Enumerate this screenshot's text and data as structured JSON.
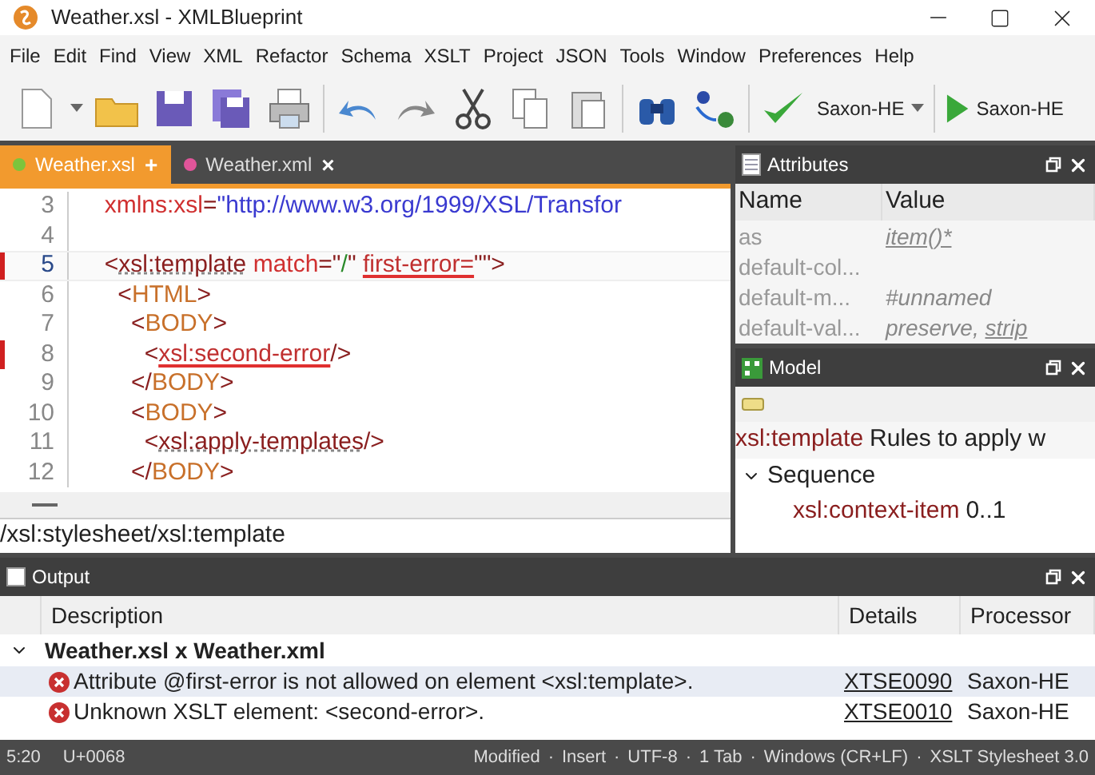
{
  "window": {
    "title": "Weather.xsl - XMLBlueprint"
  },
  "menu": [
    "File",
    "Edit",
    "Find",
    "View",
    "XML",
    "Refactor",
    "Schema",
    "XSLT",
    "Project",
    "JSON",
    "Tools",
    "Window",
    "Preferences",
    "Help"
  ],
  "toolbar": {
    "processor": "Saxon-HE",
    "run_label": "Saxon-HE"
  },
  "editor": {
    "tabs": [
      {
        "label": "Weather.xsl",
        "selected": true,
        "color": "#7cc43c",
        "action": "+"
      },
      {
        "label": "Weather.xml",
        "selected": false,
        "color": "#e0559a",
        "action": "×"
      }
    ],
    "lines": [
      {
        "number": "3",
        "error": false,
        "current": false,
        "tokens": [
          {
            "kind": "attr",
            "text": "  xmlns:xsl"
          },
          {
            "kind": "punct",
            "text": "="
          },
          {
            "kind": "value",
            "text": "\"http://www.w3.org/1999/XSL/Transfor"
          }
        ]
      },
      {
        "number": "4",
        "error": false,
        "current": false
      },
      {
        "number": "5",
        "error": true,
        "current": true,
        "tokens": [
          {
            "kind": "punct",
            "text": "  <"
          },
          {
            "kind": "tag",
            "text": "xsl:template"
          },
          {
            "kind": "attr",
            "text": " match"
          },
          {
            "kind": "punct",
            "text": "=\""
          },
          {
            "kind": "string",
            "text": "/"
          },
          {
            "kind": "punct",
            "text": "\" "
          },
          {
            "kind": "error",
            "text": "first-error="
          },
          {
            "kind": "punct",
            "text": "\"\">"
          }
        ]
      },
      {
        "number": "6",
        "error": false,
        "current": false,
        "tokens": [
          {
            "kind": "punct",
            "text": "    <"
          },
          {
            "kind": "html",
            "text": "HTML"
          },
          {
            "kind": "punct",
            "text": ">"
          }
        ]
      },
      {
        "number": "7",
        "error": false,
        "current": false,
        "tokens": [
          {
            "kind": "punct",
            "text": "      <"
          },
          {
            "kind": "html",
            "text": "BODY"
          },
          {
            "kind": "punct",
            "text": ">"
          }
        ]
      },
      {
        "number": "8",
        "error": true,
        "current": false,
        "tokens": [
          {
            "kind": "punct",
            "text": "        <"
          },
          {
            "kind": "error",
            "text": "xsl:second-error"
          },
          {
            "kind": "punct",
            "text": "/>"
          }
        ]
      },
      {
        "number": "9",
        "error": false,
        "current": false,
        "tokens": [
          {
            "kind": "punct",
            "text": "      </"
          },
          {
            "kind": "html",
            "text": "BODY"
          },
          {
            "kind": "punct",
            "text": ">"
          }
        ]
      },
      {
        "number": "10",
        "error": false,
        "current": false,
        "tokens": [
          {
            "kind": "punct",
            "text": "      <"
          },
          {
            "kind": "html",
            "text": "BODY"
          },
          {
            "kind": "punct",
            "text": ">"
          }
        ]
      },
      {
        "number": "11",
        "error": false,
        "current": false,
        "tokens": [
          {
            "kind": "punct",
            "text": "        <"
          },
          {
            "kind": "tag",
            "text": "xsl:apply-templates"
          },
          {
            "kind": "punct",
            "text": "/>"
          }
        ]
      },
      {
        "number": "12",
        "error": false,
        "current": false,
        "tokens": [
          {
            "kind": "punct",
            "text": "      </"
          },
          {
            "kind": "html",
            "text": "BODY"
          },
          {
            "kind": "punct",
            "text": ">"
          }
        ]
      }
    ],
    "path": [
      {
        "text": "/xsl:stylesheet"
      },
      {
        "text": "/xsl:template"
      }
    ]
  },
  "attributes": {
    "title": "Attributes",
    "columns": [
      "Name",
      "Value"
    ],
    "rows": [
      {
        "name": "as",
        "value": [
          {
            "text": "item()*",
            "underlined": true
          }
        ]
      },
      {
        "name": "default-col..."
      },
      {
        "name": "default-m...",
        "value": [
          {
            "text": "#unnamed",
            "underlined": false
          }
        ]
      },
      {
        "name": "default-val...",
        "value": [
          {
            "text": "preserve, ",
            "underlined": false
          },
          {
            "text": "strip",
            "underlined": true
          }
        ]
      }
    ]
  },
  "model": {
    "title": "Model",
    "element": "xsl:template",
    "description": "Rules to apply w",
    "tree": [
      {
        "label": "Sequence",
        "expanded": true,
        "children": [
          {
            "element": "xsl:context-item",
            "count": "0..1"
          }
        ]
      }
    ]
  },
  "output": {
    "title": "Output",
    "columns": [
      "Description",
      "Details",
      "Processor"
    ],
    "groups": [
      {
        "label": "Weather.xsl x Weather.xml",
        "expanded": true,
        "rows": [
          {
            "description": "Attribute @first-error is not allowed on element <xsl:template>.",
            "details": "XTSE0090",
            "processor": "Saxon-HE",
            "selected": true
          },
          {
            "description": "Unknown XSLT element: <second-error>.",
            "details": "XTSE0010",
            "processor": "Saxon-HE",
            "selected": false
          }
        ]
      }
    ]
  },
  "status_bar": {
    "position": "5:20",
    "char": "U+0068",
    "items": [
      "Modified",
      "Insert",
      "UTF-8",
      "1 Tab",
      "Windows (CR+LF)",
      "XSLT Stylesheet 3.0"
    ],
    "separator": "·"
  }
}
